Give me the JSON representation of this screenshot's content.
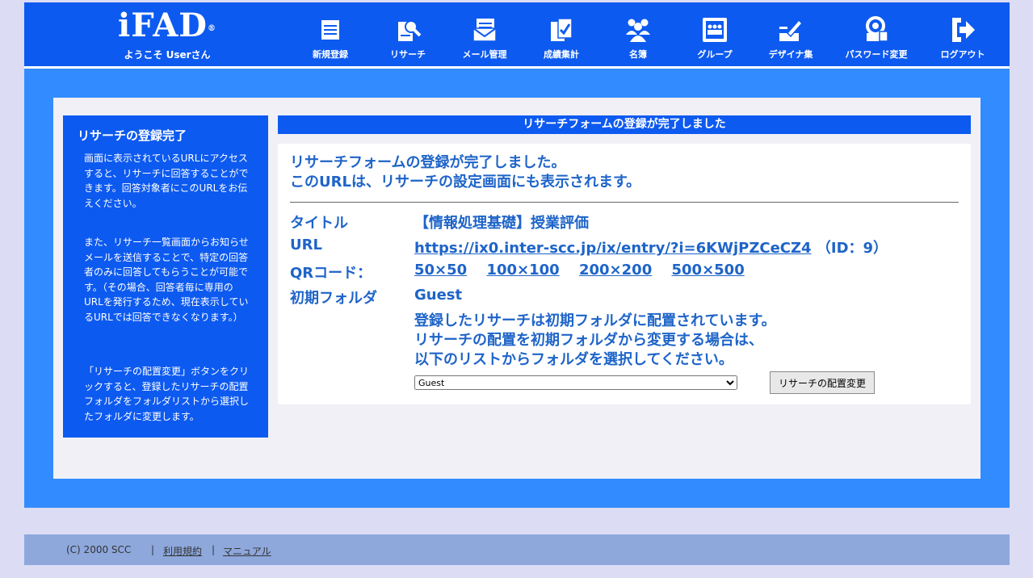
{
  "header": {
    "logo": "iFAD",
    "logo_reg": "®",
    "welcome": "ようこそ Userさん",
    "nav": [
      {
        "label": "新規登録",
        "icon": "document-icon"
      },
      {
        "label": "リサーチ",
        "icon": "research-icon"
      },
      {
        "label": "メール管理",
        "icon": "mail-icon"
      },
      {
        "label": "成績集計",
        "icon": "grades-icon"
      },
      {
        "label": "名簿",
        "icon": "people-icon"
      },
      {
        "label": "グループ",
        "icon": "group-icon"
      },
      {
        "label": "デザイナ集",
        "icon": "design-icon"
      },
      {
        "label": "パスワード変更",
        "icon": "password-icon"
      },
      {
        "label": "ログアウト",
        "icon": "logout-icon"
      }
    ]
  },
  "sidebar": {
    "title": "リサーチの登録完了",
    "para1": "画面に表示されているURLにアクセスすると、リサーチに回答することができます。回答対象者にこのURLをお伝えください。",
    "para2": "また、リサーチ一覧画面からお知らせメールを送信することで、特定の回答者のみに回答してもらうことが可能です。（その場合、回答者毎に専用のURLを発行するため、現在表示しているURLでは回答できなくなります。）",
    "para3": "「リサーチの配置変更」ボタンをクリックすると、登録したリサーチの配置フォルダをフォルダリストから選択したフォルダに変更します。"
  },
  "main": {
    "title_bar": "リサーチフォームの登録が完了しました",
    "message_line1": "リサーチフォームの登録が完了しました。",
    "message_line2": "このURLは、リサーチの設定画面にも表示されます。",
    "title_label": "タイトル",
    "title_value": "【情報処理基礎】授業評価",
    "url_label": "URL",
    "url_value": "https://ix0.inter-scc.jp/ix/entry/?i=6KWjPZCeCZ4",
    "id_text": "（ID：9）",
    "qr_label": "QRコード：",
    "qr_sizes": [
      "50×50",
      "100×100",
      "200×200",
      "500×500"
    ],
    "folder_label": "初期フォルダ",
    "folder_value": "Guest",
    "note_line1": "登録したリサーチは初期フォルダに配置されています。",
    "note_line2": "リサーチの配置を初期フォルダから変更する場合は、",
    "note_line3": "以下のリストからフォルダを選択してください。",
    "folder_select": "Guest",
    "move_button": "リサーチの配置変更"
  },
  "footer": {
    "copyright": "(C) 2000 SCC",
    "separator": "|",
    "terms": "利用規約",
    "manual": "マニュアル"
  }
}
